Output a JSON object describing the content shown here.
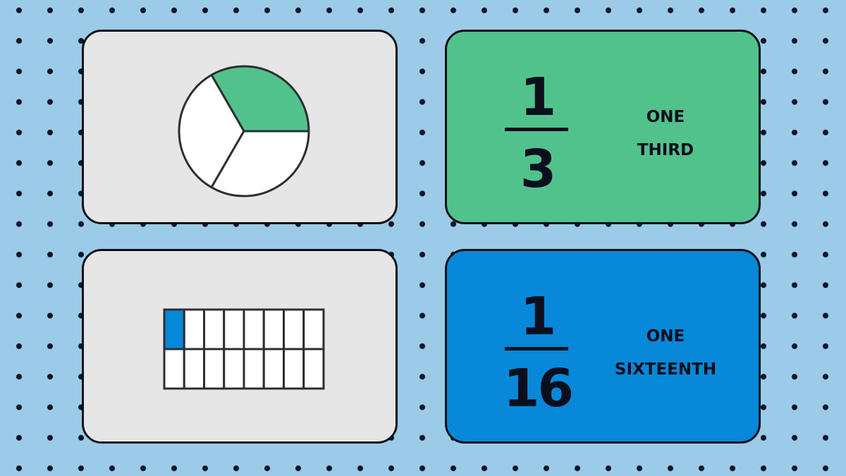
{
  "colors": {
    "background": "#9ccbe8",
    "card_gray": "#e6e6e6",
    "green": "#52c28c",
    "blue": "#0788d8",
    "ink": "#0a0f1e"
  },
  "cards": [
    {
      "type": "pie",
      "slices": 3,
      "shaded": 1,
      "shade_color": "#52c28c"
    },
    {
      "type": "fraction",
      "numerator": "1",
      "denominator": "3",
      "words": [
        "ONE",
        "THIRD"
      ]
    },
    {
      "type": "grid",
      "rows": 2,
      "cols": 8,
      "shaded": 1,
      "shade_color": "#0788d8"
    },
    {
      "type": "fraction",
      "numerator": "1",
      "denominator": "16",
      "words": [
        "ONE",
        "SIXTEENTH"
      ]
    }
  ]
}
